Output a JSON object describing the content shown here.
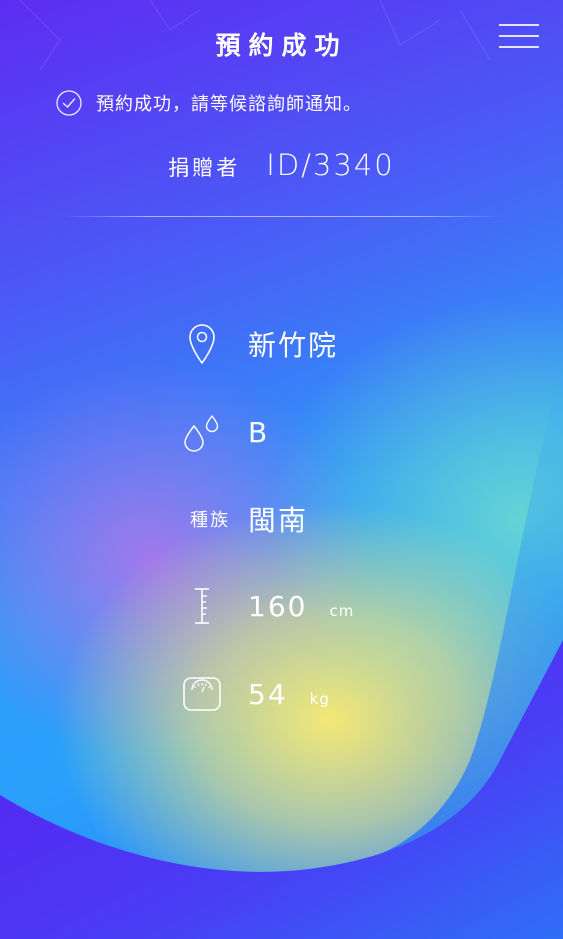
{
  "header": {
    "title": "預約成功",
    "menu_icon": "hamburger-menu-icon"
  },
  "status": {
    "icon": "check-circle-icon",
    "message": "預約成功，請等候諮詢師通知。"
  },
  "donor": {
    "label": "捐贈者",
    "id": "ID/3340"
  },
  "info": {
    "location": {
      "icon": "location-pin-icon",
      "value": "新竹院"
    },
    "blood_type": {
      "icon": "blood-drops-icon",
      "value": "B"
    },
    "ethnicity": {
      "label": "種族",
      "value": "閩南"
    },
    "height": {
      "icon": "ruler-icon",
      "value": "160",
      "unit": "cm"
    },
    "weight": {
      "icon": "scale-icon",
      "value": "54",
      "unit": "kg"
    }
  },
  "colors": {
    "background_top": "#5d2cf2",
    "background_mid": "#2c9bf9",
    "highlight_yellow": "#ffec6e",
    "text": "#ffffff"
  }
}
